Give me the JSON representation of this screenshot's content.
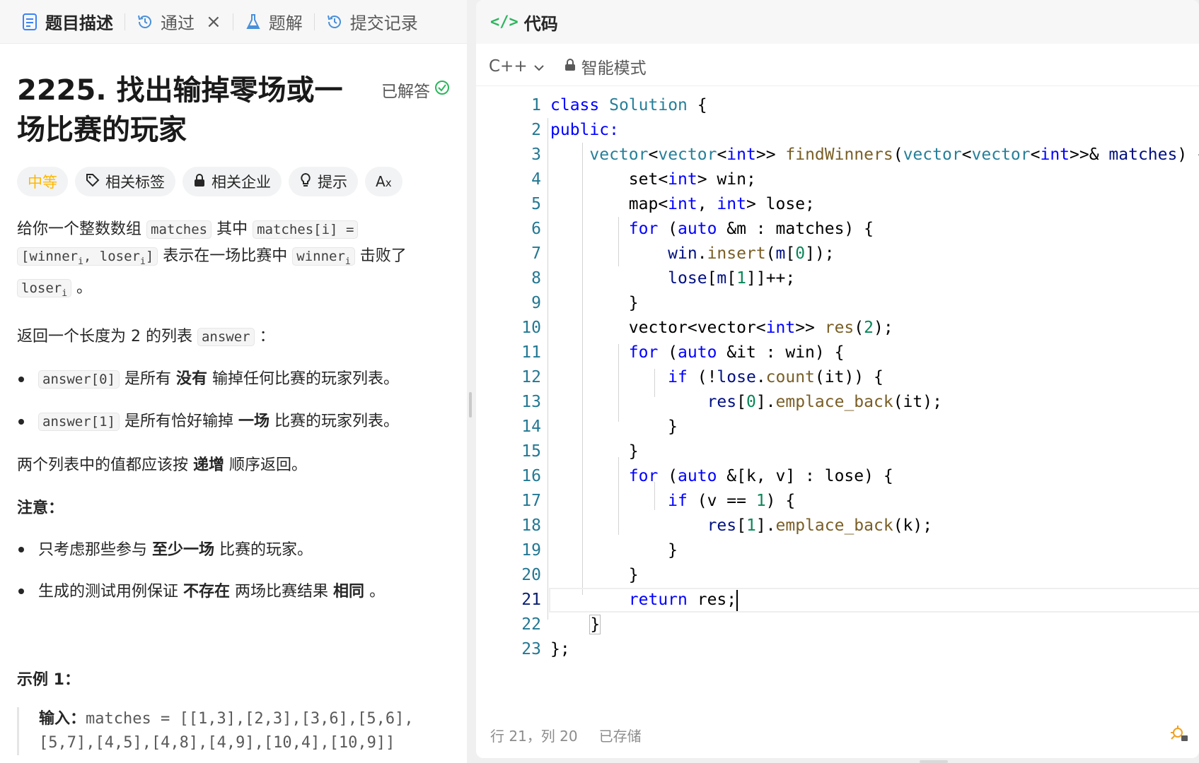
{
  "tabs": [
    {
      "label": "题目描述",
      "icon": "document-icon"
    },
    {
      "label": "通过",
      "icon": "history-icon"
    },
    {
      "label": "题解",
      "icon": "flask-icon"
    },
    {
      "label": "提交记录",
      "icon": "history-icon"
    }
  ],
  "problem": {
    "title": "2225. 找出输掉零场或一场比赛的玩家",
    "solved_label": "已解答",
    "tags": [
      "中等",
      "相关标签",
      "相关企业",
      "提示"
    ],
    "desc": {
      "p1_a": "给你一个整数数组",
      "p1_matches": "matches",
      "p1_b": "其中",
      "p1_code1": "matches[i] =",
      "p1_code2a": "[winner",
      "p1_code2b": "i",
      "p1_code2c": ", loser",
      "p1_code2d": "i",
      "p1_code2e": "]",
      "p1_c": "表示在一场比赛中",
      "p1_code3a": "winner",
      "p1_code3b": "i",
      "p1_d": "击败了",
      "p1_code4a": "loser",
      "p1_code4b": "i",
      "p1_e": "。",
      "p2_a": "返回一个长度为 2 的列表",
      "p2_code": "answer",
      "p2_b": "：",
      "b1_code": "answer[0]",
      "b1_a": "是所有",
      "b1_bold": "没有",
      "b1_b": "输掉任何比赛的玩家列表。",
      "b2_code": "answer[1]",
      "b2_a": "是所有恰好输掉",
      "b2_bold": "一场",
      "b2_b": "比赛的玩家列表。",
      "p3_a": "两个列表中的值都应该按",
      "p3_bold": "递增",
      "p3_b": "顺序返回。",
      "note": "注意：",
      "n1_a": "只考虑那些参与",
      "n1_bold": "至少一场",
      "n1_b": "比赛的玩家。",
      "n2_a": "生成的测试用例保证",
      "n2_bold1": "不存在",
      "n2_b": "两场比赛结果",
      "n2_bold2": "相同",
      "n2_c": "。"
    },
    "example_title": "示例 1：",
    "example_input_label": "输入：",
    "example_input_line1": "matches = [[1,3],[2,3],[3,6],[5,6],",
    "example_input_line2": "[5,7],[4,5],[4,8],[4,9],[10,4],[10,9]]"
  },
  "editor": {
    "header": "代码",
    "language": "C++",
    "mode": "智能模式",
    "line_numbers": [
      "1",
      "2",
      "3",
      "4",
      "5",
      "6",
      "7",
      "8",
      "9",
      "10",
      "11",
      "12",
      "13",
      "14",
      "15",
      "16",
      "17",
      "18",
      "19",
      "20",
      "21",
      "22",
      "23"
    ],
    "current_line": 21,
    "status_position": "行 21，列 20",
    "status_saved": "已存储"
  }
}
